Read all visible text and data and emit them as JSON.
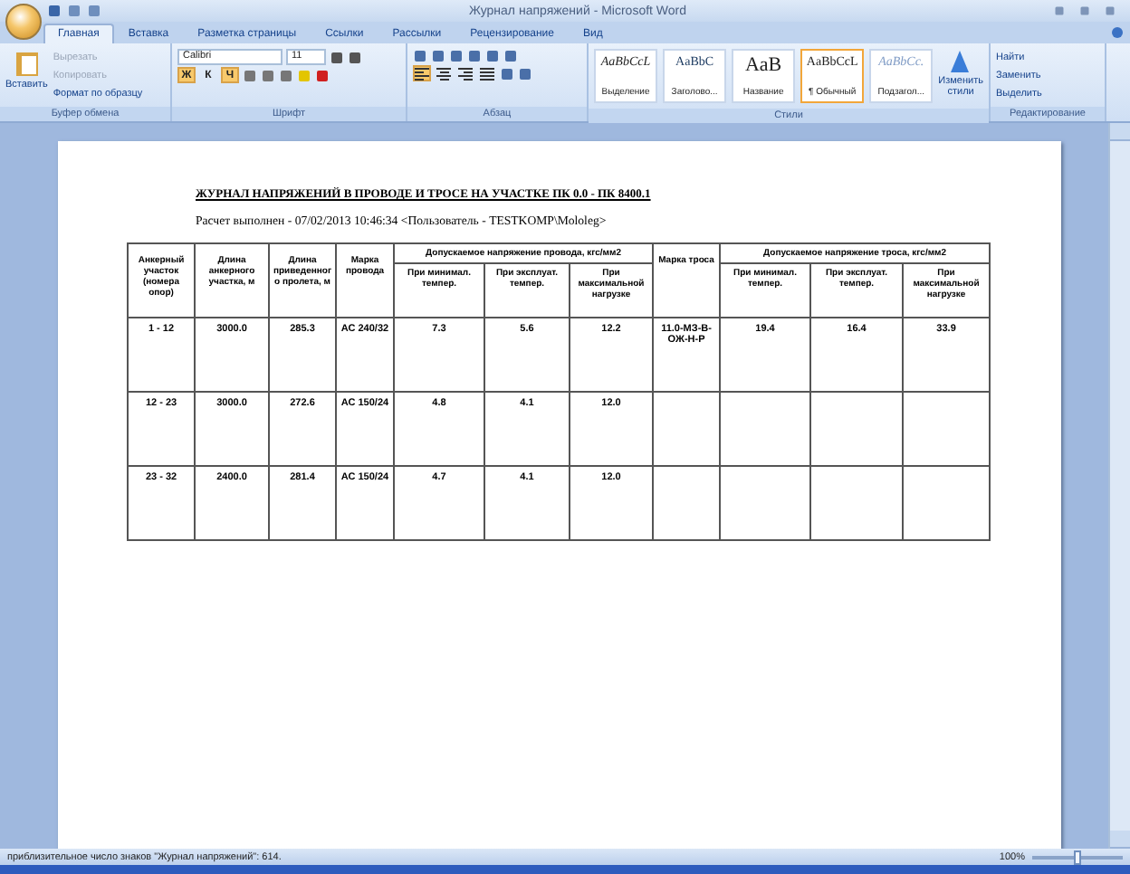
{
  "window": {
    "title": "Журнал напряжений - Microsoft Word"
  },
  "tabs": [
    {
      "label": "Главная",
      "selected": true
    },
    {
      "label": "Вставка",
      "selected": false
    },
    {
      "label": "Разметка страницы",
      "selected": false
    },
    {
      "label": "Ссылки",
      "selected": false
    },
    {
      "label": "Рассылки",
      "selected": false
    },
    {
      "label": "Рецензирование",
      "selected": false
    },
    {
      "label": "Вид",
      "selected": false
    }
  ],
  "clipboard": {
    "label": "Буфер обмена",
    "paste": "Вставить",
    "items": [
      {
        "label": "Вырезать",
        "disabled": true
      },
      {
        "label": "Копировать",
        "disabled": true
      },
      {
        "label": "Формат по образцу",
        "disabled": false
      }
    ]
  },
  "font": {
    "label": "Шрифт",
    "name": "Calibri",
    "size": "11",
    "styles": [
      {
        "glyph": "Ж",
        "selected": true
      },
      {
        "glyph": "К",
        "selected": false
      },
      {
        "glyph": "Ч",
        "selected": true
      }
    ]
  },
  "paragraph": {
    "label": "Абзац",
    "align": [
      {
        "selected": true
      },
      {
        "selected": false
      },
      {
        "selected": false
      },
      {
        "selected": false
      }
    ]
  },
  "styles": {
    "label": "Стили",
    "items": [
      {
        "sample": "AaBbCcL",
        "name": "Выделение",
        "selected": false
      },
      {
        "sample": "AaBbC",
        "name": "Заголово...",
        "selected": false
      },
      {
        "sample": "AaB",
        "name": "Название",
        "selected": false
      },
      {
        "sample": "AaBbCcL",
        "name": "¶ Обычный",
        "selected": true
      },
      {
        "sample": "AaBbCc.",
        "name": "Подзагол...",
        "selected": false
      }
    ],
    "change": "Изменить стили"
  },
  "editing": {
    "label": "Редактирование",
    "items": [
      "Найти",
      "Заменить",
      "Выделить"
    ]
  },
  "document": {
    "heading": "ЖУРНАЛ НАПРЯЖЕНИЙ В ПРОВОДЕ И ТРОСЕ НА УЧАСТКЕ ПК 0.0 - ПК 8400.1",
    "subtitle": "Расчет выполнен - 07/02/2013 10:46:34  <Пользователь - TESTKOMP\\Mololeg>",
    "table": {
      "columns": [
        "Анкерный участок (номера опор)",
        "Длина анкерного участка, м",
        "Длина приведенного пролета, м",
        "Марка провода"
      ],
      "wire_group": {
        "title": "Допускаемое напряжение провода, кгс/мм2",
        "columns": [
          "При минимал. темпер.",
          "При эксплуат. темпер.",
          "При максимальной нагрузке"
        ]
      },
      "rope_column": "Марка троса",
      "rope_group": {
        "title": "Допускаемое напряжение троса, кгс/мм2",
        "columns": [
          "При минимал. темпер.",
          "При эксплуат. темпер.",
          "При максимальной нагрузке"
        ]
      },
      "rows": [
        [
          "1 - 12",
          "3000.0",
          "285.3",
          "АС 240/32",
          "7.3",
          "5.6",
          "12.2",
          "11.0-МЗ-В-ОЖ-Н-Р",
          "19.4",
          "16.4",
          "33.9"
        ],
        [
          "12 - 23",
          "3000.0",
          "272.6",
          "АС 150/24",
          "4.8",
          "4.1",
          "12.0",
          null,
          null,
          null,
          null
        ],
        [
          "23 - 32",
          "2400.0",
          "281.4",
          "АС 150/24",
          "4.7",
          "4.1",
          "12.0",
          null,
          null,
          null,
          null
        ]
      ]
    }
  },
  "status_bar": {
    "text": "приблизительное число знаков \"Журнал напряжений\": 614.",
    "zoom": "100%",
    "zoom_slider": {
      "level": 0.5
    }
  }
}
